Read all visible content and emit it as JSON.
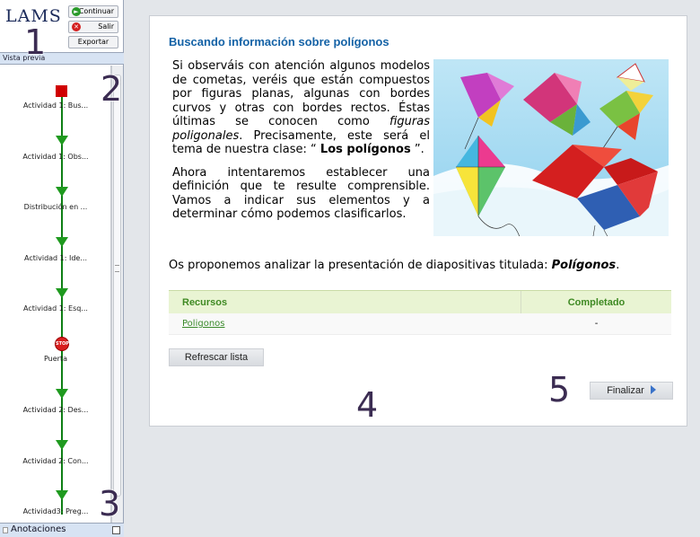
{
  "app": {
    "logo": "LAMS"
  },
  "topbar": {
    "continuar_label": "Continuar",
    "salir_label": "Salir",
    "exportar_label": "Exportar"
  },
  "sidebar": {
    "header": "Vista previa",
    "activities": [
      {
        "label": "Actividad 1: Bus...",
        "marker": "red-square"
      },
      {
        "label": "Actividad 1: Obs...",
        "marker": "green-arrow"
      },
      {
        "label": "Distribución en ...",
        "marker": "green-arrow"
      },
      {
        "label": "Actividad 1: Ide...",
        "marker": "green-arrow"
      },
      {
        "label": "Actividad 1: Esq...",
        "marker": "green-arrow"
      },
      {
        "label": "Puerta",
        "marker": "stop-sign"
      },
      {
        "label": "Actividad 2: Des...",
        "marker": "green-arrow"
      },
      {
        "label": "Actividad 2: Con...",
        "marker": "green-arrow"
      },
      {
        "label": "Actividad3: Preg...",
        "marker": "green-arrow"
      }
    ],
    "stop_text": "STOP",
    "footer": "Anotaciones"
  },
  "callouts": [
    "1",
    "2",
    "3",
    "4",
    "5"
  ],
  "content": {
    "title": "Buscando información sobre polígonos",
    "p1_a": "Si observáis con atención algunos modelos de cometas, veréis que están compuestos por figuras planas, algunas con bordes curvos y otras con bordes rectos. Éstas últimas se conocen como ",
    "p1_em": "figuras poligonales",
    "p1_b": ". Precisamente, este será el tema de nuestra clase: “ ",
    "p1_strong": "Los polígonos",
    "p1_c": " ”.",
    "p2": "Ahora intentaremos establecer una definición que te resulte comprensible. Vamos a indicar sus elementos y a determinar cómo podemos clasificarlos.",
    "propon_a": "Os proponemos analizar la presentación de diapositivas titulada: ",
    "propon_em": "Polígonos",
    "propon_end": ".",
    "table": {
      "headers": [
        "Recursos",
        "Completado"
      ],
      "rows": [
        {
          "resource": "Poligonos",
          "completed": "-"
        }
      ]
    },
    "refrescar_label": "Refrescar lista",
    "finalizar_label": "Finalizar"
  },
  "colors": {
    "title_blue": "#1462a6",
    "table_header_bg": "#e9f4d3",
    "table_header_text": "#3f8a23",
    "sequence_green": "#1f9a1f"
  }
}
